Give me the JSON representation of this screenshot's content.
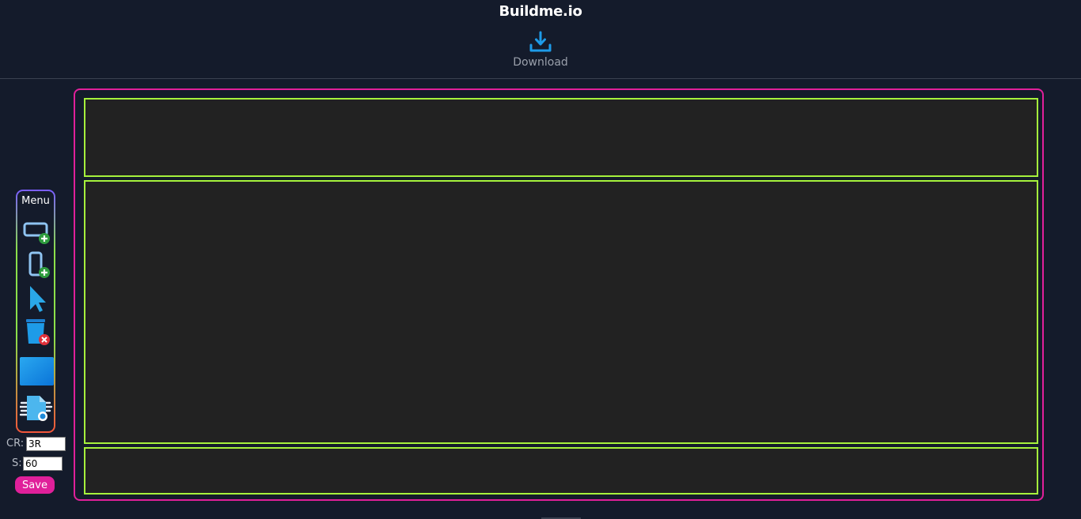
{
  "header": {
    "brand": "Buildme.io",
    "download_label": "Download"
  },
  "menu": {
    "title": "Menu",
    "tools": [
      {
        "icon": "add-horizontal-block-icon"
      },
      {
        "icon": "add-vertical-block-icon"
      },
      {
        "icon": "cursor-select-icon"
      },
      {
        "icon": "delete-bin-icon"
      },
      {
        "icon": "color-fill-icon"
      },
      {
        "icon": "export-document-icon"
      }
    ]
  },
  "settings": {
    "cr_label": "CR:",
    "cr_value": "3R",
    "s_label": "S:",
    "s_value": "60",
    "save_label": "Save"
  },
  "colors": {
    "background": "#141b2b",
    "frame_border": "#e0209a",
    "section_border": "#a6f23c",
    "section_fill": "#222222",
    "accent_blue": "#1e9be8"
  }
}
